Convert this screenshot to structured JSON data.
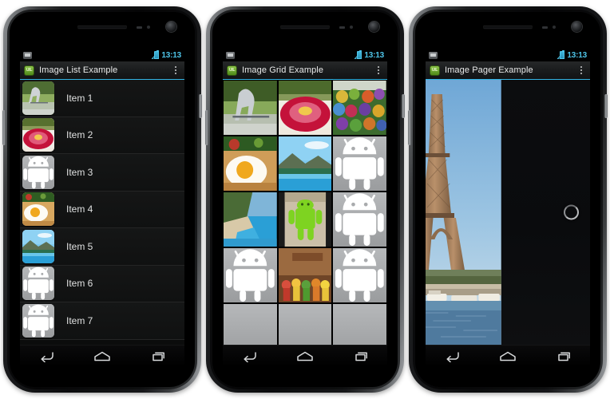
{
  "page": {
    "background": "#ffffff",
    "accent_color": "#33b5e5",
    "device_count": 3
  },
  "status_bar": {
    "time": "13:13",
    "time_color": "#4ec4e8",
    "icons": [
      "notification-icon",
      "signal-icon",
      "battery-icon"
    ]
  },
  "nav_bar": {
    "buttons": [
      "back-button",
      "home-button",
      "recents-button"
    ]
  },
  "phones": [
    {
      "id": "phone-list",
      "title": "Image List Example",
      "logo_text": "UIL",
      "overflow_label": "",
      "screen_type": "list",
      "list_items": [
        {
          "label": "Item 1",
          "image": "horse-statue"
        },
        {
          "label": "Item 2",
          "image": "red-flower-bowl"
        },
        {
          "label": "Item 3",
          "image": "android-placeholder"
        },
        {
          "label": "Item 4",
          "image": "fried-egg"
        },
        {
          "label": "Item 5",
          "image": "beach-pool"
        },
        {
          "label": "Item 6",
          "image": "android-placeholder"
        },
        {
          "label": "Item 7",
          "image": "android-placeholder"
        }
      ]
    },
    {
      "id": "phone-grid",
      "title": "Image Grid Example",
      "logo_text": "UIL",
      "screen_type": "grid",
      "columns": 3,
      "grid_items": [
        {
          "image": "horse-statue"
        },
        {
          "image": "red-flower-bowl"
        },
        {
          "image": "fruit-market"
        },
        {
          "image": "fried-egg"
        },
        {
          "image": "beach-pool"
        },
        {
          "image": "android-placeholder"
        },
        {
          "image": "coast-beach"
        },
        {
          "image": "green-android-toy"
        },
        {
          "image": "android-placeholder"
        },
        {
          "image": "android-placeholder"
        },
        {
          "image": "android-figures"
        },
        {
          "image": "android-placeholder"
        },
        {
          "image": "android-placeholder"
        },
        {
          "image": "android-placeholder"
        },
        {
          "image": "android-placeholder"
        }
      ]
    },
    {
      "id": "phone-pager",
      "title": "Image Pager Example",
      "logo_text": "UIL",
      "screen_type": "pager",
      "current_page_image": "eiffel-tower",
      "next_page_state": "loading",
      "loading_indicator": "circular-progress"
    }
  ]
}
